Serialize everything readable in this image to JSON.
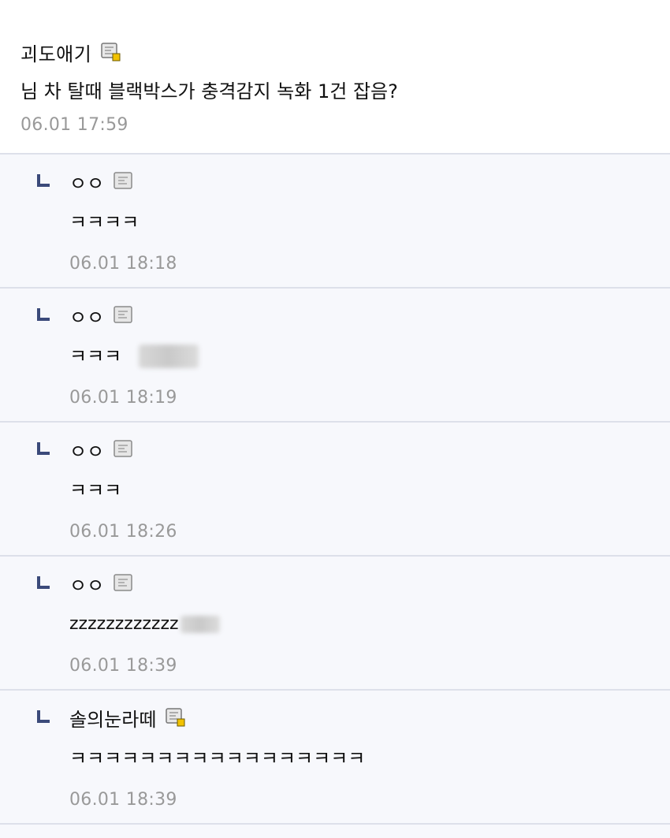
{
  "post": {
    "nickname": "괴도애기",
    "badge_icon": "member-badge-icon",
    "text": "님 차 탈때 블랙박스가 충격감지 녹화 1건 잡음?",
    "time": "06.01 17:59"
  },
  "replies": [
    {
      "nickname": "ㅇㅇ",
      "badge_icon": "guest-badge-icon",
      "text": "ㅋㅋㅋㅋ",
      "time": "06.01 18:18"
    },
    {
      "nickname": "ㅇㅇ",
      "badge_icon": "guest-badge-icon",
      "text": "ㅋㅋㅋ",
      "time": "06.01 18:19"
    },
    {
      "nickname": "ㅇㅇ",
      "badge_icon": "guest-badge-icon",
      "text": "ㅋㅋㅋ",
      "time": "06.01 18:26"
    },
    {
      "nickname": "ㅇㅇ",
      "badge_icon": "guest-badge-icon",
      "text": "zzzzzzzzzzzz",
      "time": "06.01 18:39"
    },
    {
      "nickname": "솔의눈라떼",
      "badge_icon": "member-badge-icon",
      "text": "ㅋㅋㅋㅋㅋㅋㅋㅋㅋㅋㅋㅋㅋㅋㅋㅋㅋ",
      "time": "06.01 18:39"
    }
  ],
  "colors": {
    "reply_mark": "#3b4a7a",
    "divider": "#dde0ea",
    "timestamp": "#999999",
    "badge_dot": "#f2c200"
  }
}
